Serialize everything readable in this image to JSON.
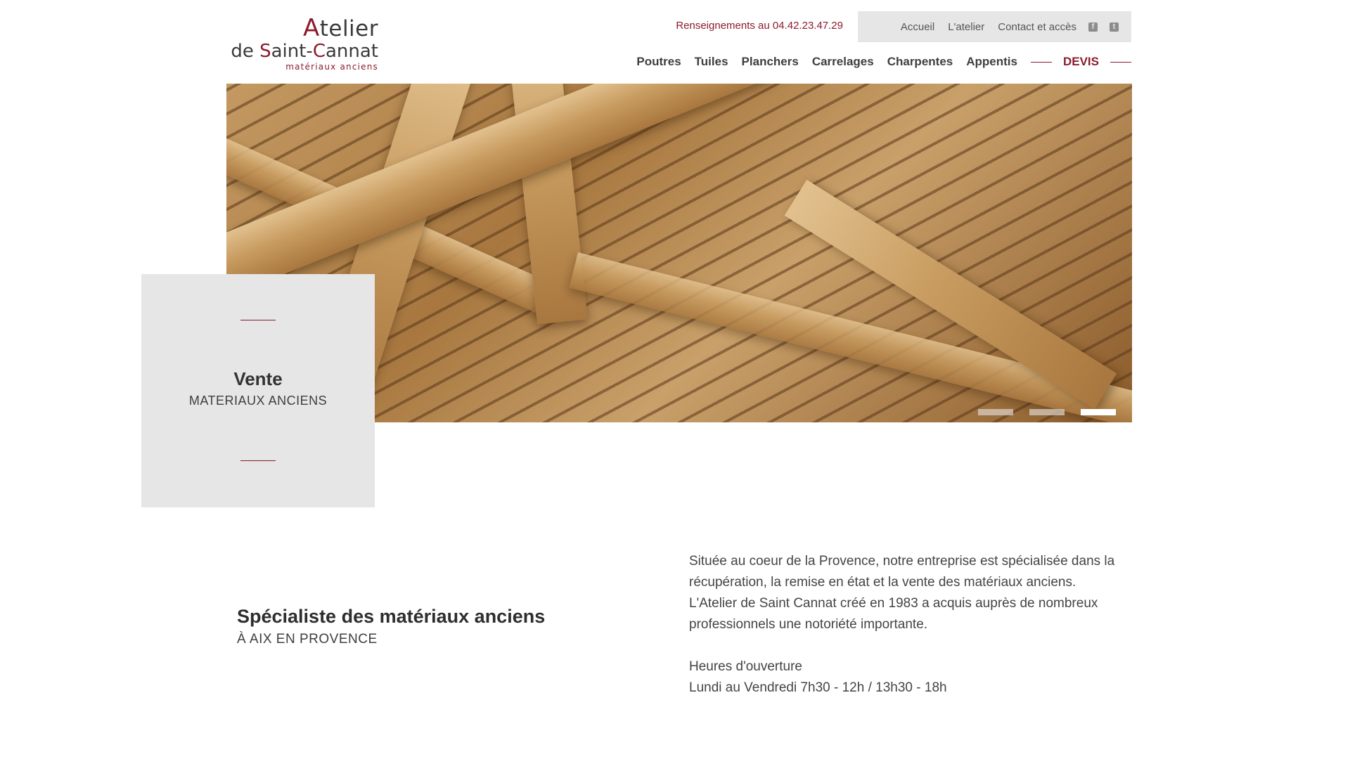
{
  "logo": {
    "line1_cap": "A",
    "line1_rest": "telier",
    "line2_de": "de ",
    "line2_s": "S",
    "line2_aint": "aint-",
    "line2_c": "C",
    "line2_annat": "annat",
    "tagline": "matériaux anciens"
  },
  "header": {
    "phone": "Renseignements au 04.42.23.47.29",
    "util_links": [
      "Accueil",
      "L'atelier",
      "Contact et accès"
    ],
    "social": [
      {
        "name": "facebook-icon",
        "glyph": "f"
      },
      {
        "name": "twitter-icon",
        "glyph": "t"
      }
    ],
    "nav": [
      "Poutres",
      "Tuiles",
      "Planchers",
      "Carrelages",
      "Charpentes",
      "Appentis"
    ],
    "devis": "DEVIS"
  },
  "hero": {
    "slide_count": 3,
    "active_slide": 3
  },
  "caption": {
    "title": "Vente",
    "subtitle": "MATERIAUX ANCIENS"
  },
  "intro": {
    "heading": "Spécialiste des matériaux anciens",
    "subheading": "À AIX EN PROVENCE",
    "paragraph1": "Située au coeur de la Provence, notre entreprise est spécialisée dans la récupération, la remise en état et la vente des matériaux anciens.",
    "paragraph2": "L'Atelier de Saint Cannat créé en 1983 a acquis auprès de nombreux professionnels une notoriété importante.",
    "hours_label": "Heures d'ouverture",
    "hours_value": "Lundi au Vendredi 7h30 - 12h / 13h30 - 18h"
  },
  "colors": {
    "accent": "#8a1c2c",
    "util_bar": "#e6e6e6",
    "caption_bg": "#e6e6e6",
    "text": "#333333"
  }
}
